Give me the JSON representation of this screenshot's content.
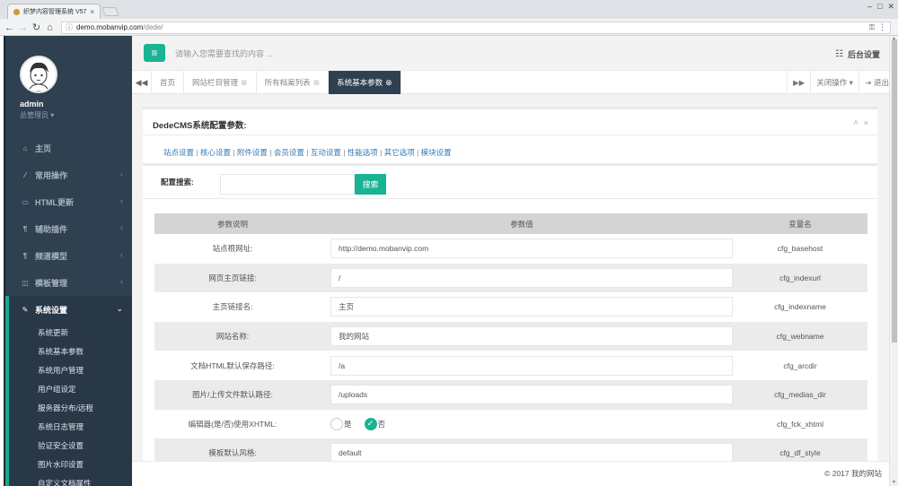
{
  "browser": {
    "tab_title": "织梦内容管理系统 V57_...",
    "tab_close": "×",
    "url_host": "demo.mobanvip.com",
    "url_path": "/dede/"
  },
  "profile": {
    "username": "admin",
    "role": "总管理员 ▾"
  },
  "sidebar": {
    "items": [
      {
        "icon": "home-icon",
        "label": "主页",
        "arrow": ""
      },
      {
        "icon": "magic-wand-icon",
        "label": "常用操作",
        "arrow": "‹"
      },
      {
        "icon": "monitor-icon",
        "label": "HTML更新",
        "arrow": "‹"
      },
      {
        "icon": "cutlery-icon",
        "label": "辅助插件",
        "arrow": "‹"
      },
      {
        "icon": "cutlery-icon",
        "label": "频道模型",
        "arrow": "‹"
      },
      {
        "icon": "columns-icon",
        "label": "模板管理",
        "arrow": "‹"
      }
    ],
    "active_item": {
      "icon": "edit-icon",
      "label": "系统设置",
      "arrow": "⌄"
    },
    "submenu": [
      "系统更新",
      "系统基本参数",
      "系统用户管理",
      "用户组设定",
      "服务器分布/远程",
      "系统日志管理",
      "验证安全设置",
      "图片水印设置",
      "自定义文档属性"
    ]
  },
  "topbar": {
    "toggle_icon": "≡",
    "search_placeholder": "请输入您需要查找的内容 ...",
    "settings_label": "后台设置"
  },
  "page_tabs": {
    "prev": "◀◀",
    "next": "▶▶",
    "tabs": [
      {
        "label": "首页",
        "closable": false
      },
      {
        "label": "网站栏目管理",
        "closable": true
      },
      {
        "label": "所有档案列表",
        "closable": true
      },
      {
        "label": "系统基本参数",
        "closable": true,
        "active": true
      }
    ],
    "close_ops": "关闭操作 ▾",
    "logout": "退出"
  },
  "panel": {
    "title": "DedeCMS系统配置参数:",
    "tools": [
      "˄",
      "×"
    ],
    "links": [
      "站点设置",
      "核心设置",
      "附件设置",
      "会员设置",
      "互动设置",
      "性能选项",
      "其它选项",
      "模块设置"
    ],
    "link_sep": " | ",
    "search_label": "配置搜索:",
    "search_value": "",
    "search_button": "搜索"
  },
  "table": {
    "headers": [
      "参数说明",
      "参数值",
      "变量名"
    ],
    "rows": [
      {
        "label": "站点根网址:",
        "value": "http://demo.mobanvip.com",
        "var": "cfg_basehost"
      },
      {
        "label": "网页主页链接:",
        "value": "/",
        "var": "cfg_indexurl"
      },
      {
        "label": "主页链接名:",
        "value": "主页",
        "var": "cfg_indexname"
      },
      {
        "label": "网站名称:",
        "value": "我的网站",
        "var": "cfg_webname"
      },
      {
        "label": "文档HTML默认保存路径:",
        "value": "/a",
        "var": "cfg_arcdir"
      },
      {
        "label": "图片/上传文件默认路径:",
        "value": "/uploads",
        "var": "cfg_medias_dir"
      },
      {
        "label": "编辑器(是/否)使用XHTML:",
        "radio": {
          "options": [
            "是",
            "否"
          ],
          "selected": "否"
        },
        "var": "cfg_fck_xhtml"
      },
      {
        "label": "模板默认风格:",
        "value": "default",
        "var": "cfg_df_style"
      }
    ]
  },
  "footer": {
    "text": "© 2017 我的网站"
  },
  "colors": {
    "sidebar_bg": "#2f4050",
    "accent": "#1ab394",
    "link": "#337ab7"
  }
}
